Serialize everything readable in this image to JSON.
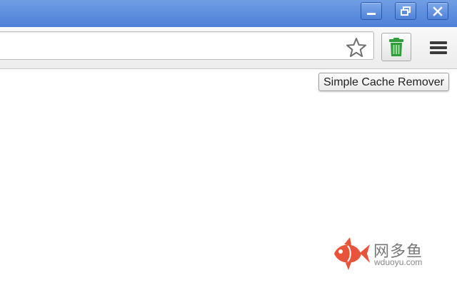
{
  "window_controls": {
    "minimize": "minimize-icon",
    "restore": "restore-icon",
    "close": "close-icon"
  },
  "toolbar": {
    "bookmark_icon": "star-outline-icon",
    "extension_icon": "trash-can-icon",
    "menu_icon": "hamburger-menu-icon",
    "extension_color": "#2e9e3a"
  },
  "tooltip": {
    "text": "Simple Cache Remover"
  },
  "watermark": {
    "title": "网多鱼",
    "subtitle": "wduoyu.com",
    "color": "#e8533b"
  }
}
